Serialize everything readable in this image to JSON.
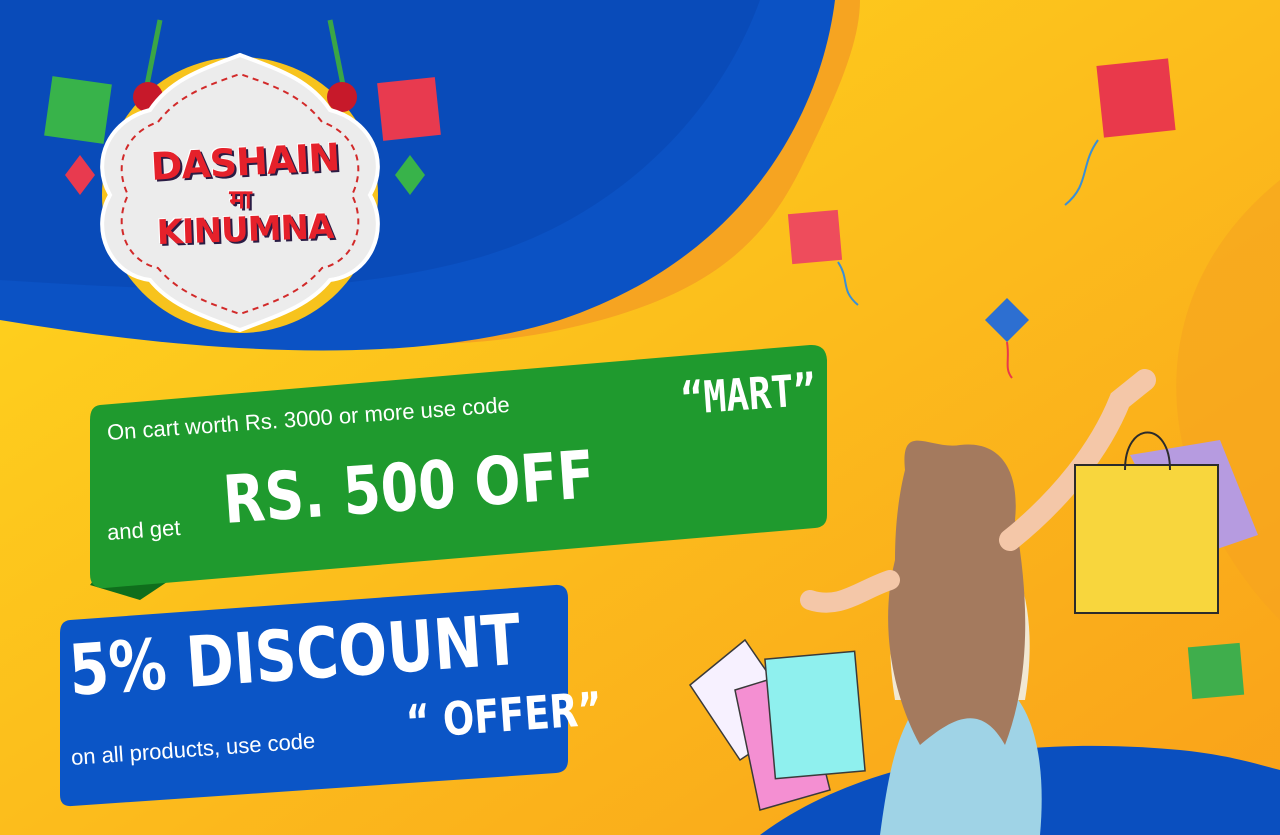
{
  "badge": {
    "line1": "DASHAIN",
    "line2": "मा",
    "line3": "KINUMNA"
  },
  "green_offer": {
    "line1": "On cart worth Rs. 3000   or more use  code",
    "code": "“MART”",
    "and_get": "and get",
    "headline": "RS. 500 OFF"
  },
  "blue_offer": {
    "headline": "5% DISCOUNT",
    "line": "on all products, use code",
    "code": "“ OFFER”"
  },
  "colors": {
    "blue": "#0a4fbf",
    "orange": "#f7a823",
    "yellow": "#ffd21f",
    "green": "#1f9a2e",
    "red": "#e5212b"
  }
}
